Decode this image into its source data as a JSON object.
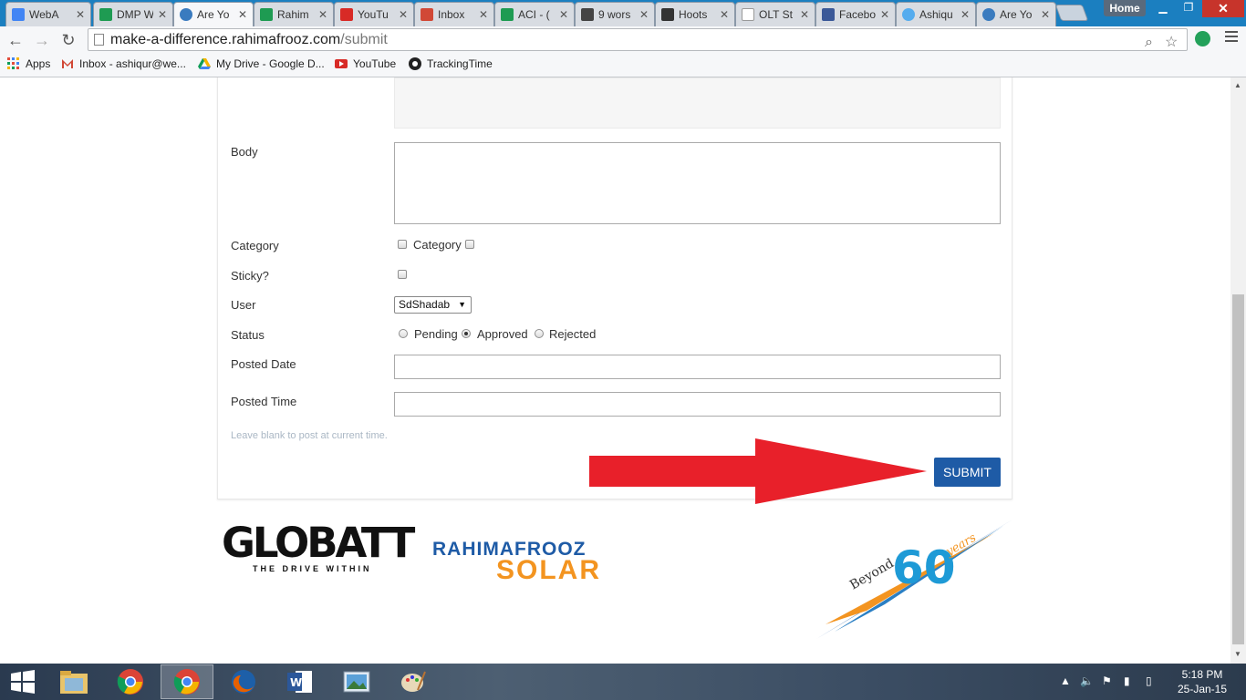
{
  "browser": {
    "tabs": [
      {
        "label": "WebA",
        "icon": "google-drive-icon",
        "color": "#4285f4"
      },
      {
        "label": "DMP W",
        "icon": "sheets-icon",
        "color": "#1e9b52"
      },
      {
        "label": "Are Yo",
        "icon": "bird-icon",
        "color": "#3a7bbf",
        "active": true
      },
      {
        "label": "Rahim",
        "icon": "sheets-icon",
        "color": "#1e9b52"
      },
      {
        "label": "YouTu",
        "icon": "youtube-icon",
        "color": "#d82a26"
      },
      {
        "label": "Inbox",
        "icon": "gmail-icon",
        "color": "#d14836"
      },
      {
        "label": "ACI - (",
        "icon": "sheets-icon",
        "color": "#1e9b52"
      },
      {
        "label": "9 wors",
        "icon": "s-logo-icon",
        "color": "#444444"
      },
      {
        "label": "Hoots",
        "icon": "owl-icon",
        "color": "#333333"
      },
      {
        "label": "OLT St",
        "icon": "page-icon",
        "color": "#999999"
      },
      {
        "label": "Facebo",
        "icon": "facebook-icon",
        "color": "#3b5998"
      },
      {
        "label": "Ashiqu",
        "icon": "twitter-icon",
        "color": "#55acee"
      },
      {
        "label": "Are Yo",
        "icon": "bird-icon",
        "color": "#3a7bbf"
      }
    ],
    "home_label": "Home",
    "url_domain": "make-a-difference.rahimafrooz.com",
    "url_path": "/submit"
  },
  "bookmarks": [
    {
      "label": "Apps",
      "icon": "apps-grid-icon"
    },
    {
      "label": "Inbox - ashiqur@we...",
      "icon": "gmail-icon"
    },
    {
      "label": "My Drive - Google D...",
      "icon": "google-drive-icon"
    },
    {
      "label": "YouTube",
      "icon": "youtube-icon"
    },
    {
      "label": "TrackingTime",
      "icon": "tracking-icon"
    }
  ],
  "form": {
    "body_label": "Body",
    "category_label": "Category",
    "category_option": "Category",
    "sticky_label": "Sticky?",
    "user_label": "User",
    "user_value": "SdShadab",
    "status_label": "Status",
    "status_options": [
      "Pending",
      "Approved",
      "Rejected"
    ],
    "status_selected": "Approved",
    "posted_date_label": "Posted Date",
    "posted_time_label": "Posted Time",
    "hint": "Leave blank to post at current time.",
    "submit_label": "SUBMIT"
  },
  "footer": {
    "globatt_name": "GLOBATT",
    "globatt_tagline": "THE DRIVE WITHIN",
    "rahimafrooz_name": "RAHIMAFROOZ",
    "solar_name": "SOLAR",
    "anniversary_beyond": "Beyond",
    "anniversary_number": "60",
    "anniversary_years": "years"
  },
  "taskbar": {
    "time": "5:18 PM",
    "date": "25-Jan-15"
  },
  "colors": {
    "submit_bg": "#1e5ba6",
    "arrow": "#e8202a",
    "solar_orange": "#f39420"
  }
}
